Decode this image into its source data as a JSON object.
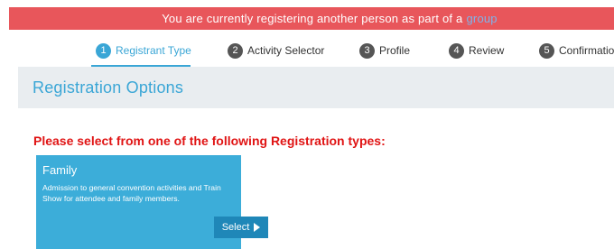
{
  "banner": {
    "text": "You are currently registering another person as part of a",
    "link": "group"
  },
  "steps": [
    {
      "num": "1",
      "label": "Registrant Type",
      "active": true
    },
    {
      "num": "2",
      "label": "Activity Selector",
      "active": false
    },
    {
      "num": "3",
      "label": "Profile",
      "active": false
    },
    {
      "num": "4",
      "label": "Review",
      "active": false
    },
    {
      "num": "5",
      "label": "Confirmation",
      "active": false
    }
  ],
  "options": {
    "title": "Registration Options"
  },
  "prompt": "Please select from one of the following Registration types:",
  "cards": [
    {
      "title": "Family",
      "description": "Admission to general convention activities and Train Show for attendee and family members.",
      "select_label": "Select"
    }
  ],
  "colors": {
    "banner_bg": "#e8565b",
    "accent": "#3aa6d6",
    "prompt": "#e01414",
    "card_bg": "#3cadd9"
  }
}
